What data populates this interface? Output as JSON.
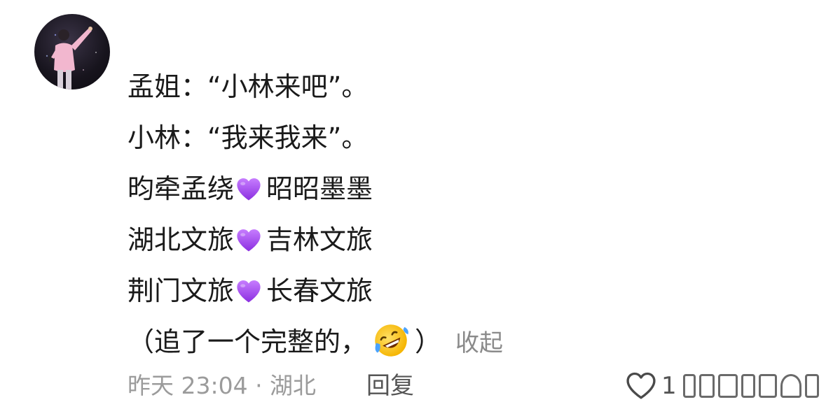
{
  "avatar": {
    "alt": "user avatar"
  },
  "comment": {
    "lines": [
      {
        "text": "孟姐：“小林来吧”。"
      },
      {
        "text": "小林：“我来我来”。"
      },
      {
        "left": "昀牵孟绕",
        "right": "昭昭墨墨"
      },
      {
        "left": "湖北文旅",
        "right": "吉林文旅"
      },
      {
        "left": "荆门文旅",
        "right": "长春文旅"
      }
    ],
    "last_line_prefix": "（追了一个完整的，",
    "last_line_suffix": "）",
    "collapse_label": "收起"
  },
  "meta": {
    "time_location": "昨天 23:04 · 湖北",
    "reply_label": "回复",
    "like_count": "1"
  },
  "icons": {
    "heart": "purple-heart-emoji",
    "laugh": "rolling-on-floor-laughing-emoji",
    "like": "heart-outline-icon"
  },
  "colors": {
    "heart": "#a855f7",
    "meta": "#9b9b9b",
    "text": "#1a1a1a",
    "collapse": "#8a8a8a"
  }
}
